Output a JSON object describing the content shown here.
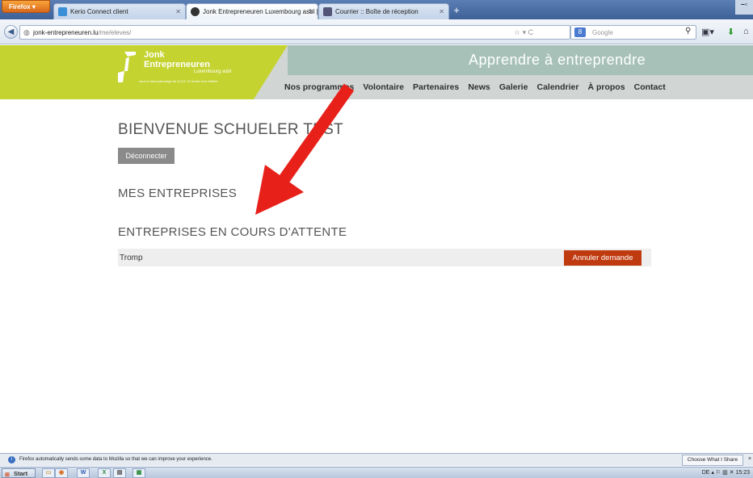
{
  "browser": {
    "menu_button": "Firefox ▾",
    "tabs": [
      {
        "label": "Kerio Connect client",
        "active": false
      },
      {
        "label": "Jonk Entrepreneuren Luxembourg asbl | ...",
        "active": true
      },
      {
        "label": "Courrier :: Boîte de réception",
        "active": false
      }
    ],
    "url_host": "jonk-entrepreneuren.lu",
    "url_path": "/me/eleves/",
    "search_placeholder": "Google",
    "search_engine_letter": "8"
  },
  "site": {
    "logo_title_line1": "Jonk",
    "logo_title_line2": "Entrepreneuren",
    "logo_sub": "Luxembourg asbl",
    "logo_tagline": "sous le haut patronage de S.A.R. le Grand-Duc Héritier",
    "tagline": "Apprendre à entreprendre",
    "nav": [
      "Nos programmes",
      "Volontaire",
      "Partenaires",
      "News",
      "Galerie",
      "Calendrier",
      "À propos",
      "Contact"
    ]
  },
  "main": {
    "welcome": "BIENVENUE SCHUELER TEST",
    "logout_label": "Déconnecter",
    "my_companies_title": "MES ENTREPRISES",
    "pending_title": "ENTREPRISES EN COURS D'ATTENTE",
    "pending": [
      {
        "name": "Tromp",
        "action_label": "Annuler demande"
      }
    ]
  },
  "notification": {
    "text": "Firefox automatically sends some data to Mozilla so that we can improve your experience.",
    "button_label": "Choose What I Share",
    "close": "×"
  },
  "taskbar": {
    "start_label": "Start",
    "lang": "DE",
    "time": "15:23"
  },
  "colors": {
    "brand_green": "#c4d330",
    "header_teal": "#a7c1b9",
    "cancel_red": "#c03a0f",
    "annotation_arrow": "#e8201a"
  }
}
